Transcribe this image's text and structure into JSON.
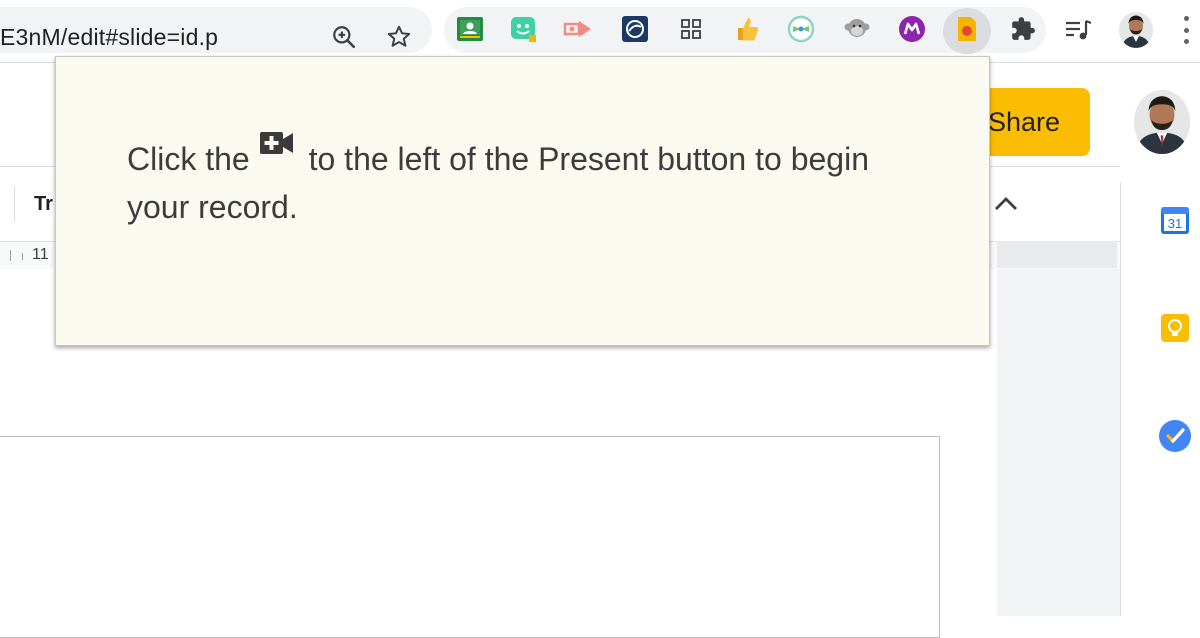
{
  "browser": {
    "url": "E3nM/edit#slide=id.p",
    "omnibox_icons": [
      "zoom-icon",
      "star-icon"
    ],
    "extensions": [
      "google-classroom-icon",
      "bitmoji-icon",
      "screencastify-icon",
      "screen-recorder-icon",
      "apps-grid-icon",
      "thumbs-up-icon",
      "bookmark-ribbon-icon",
      "monkey-icon",
      "m-logo-icon",
      "record-extension-icon",
      "extensions-puzzle-icon"
    ],
    "toolbar_icons": [
      "media-queue-icon",
      "profile-avatar",
      "menu-kebab-icon"
    ]
  },
  "app": {
    "share_label": "Share",
    "toolbar_fragment": "Tr",
    "ruler_number": "11",
    "side_panel_icons": [
      "calendar-icon",
      "keep-icon",
      "tasks-icon"
    ],
    "calendar_day": "31"
  },
  "popup": {
    "text_before_icon": "Click the",
    "text_after_icon": "to the left of the Present button to begin your record.",
    "inline_icon": "camera-plus-icon"
  },
  "colors": {
    "share_button": "#fbbc04",
    "popup_background": "#fbfaf0",
    "highlighted_extension": "#f4b400"
  }
}
